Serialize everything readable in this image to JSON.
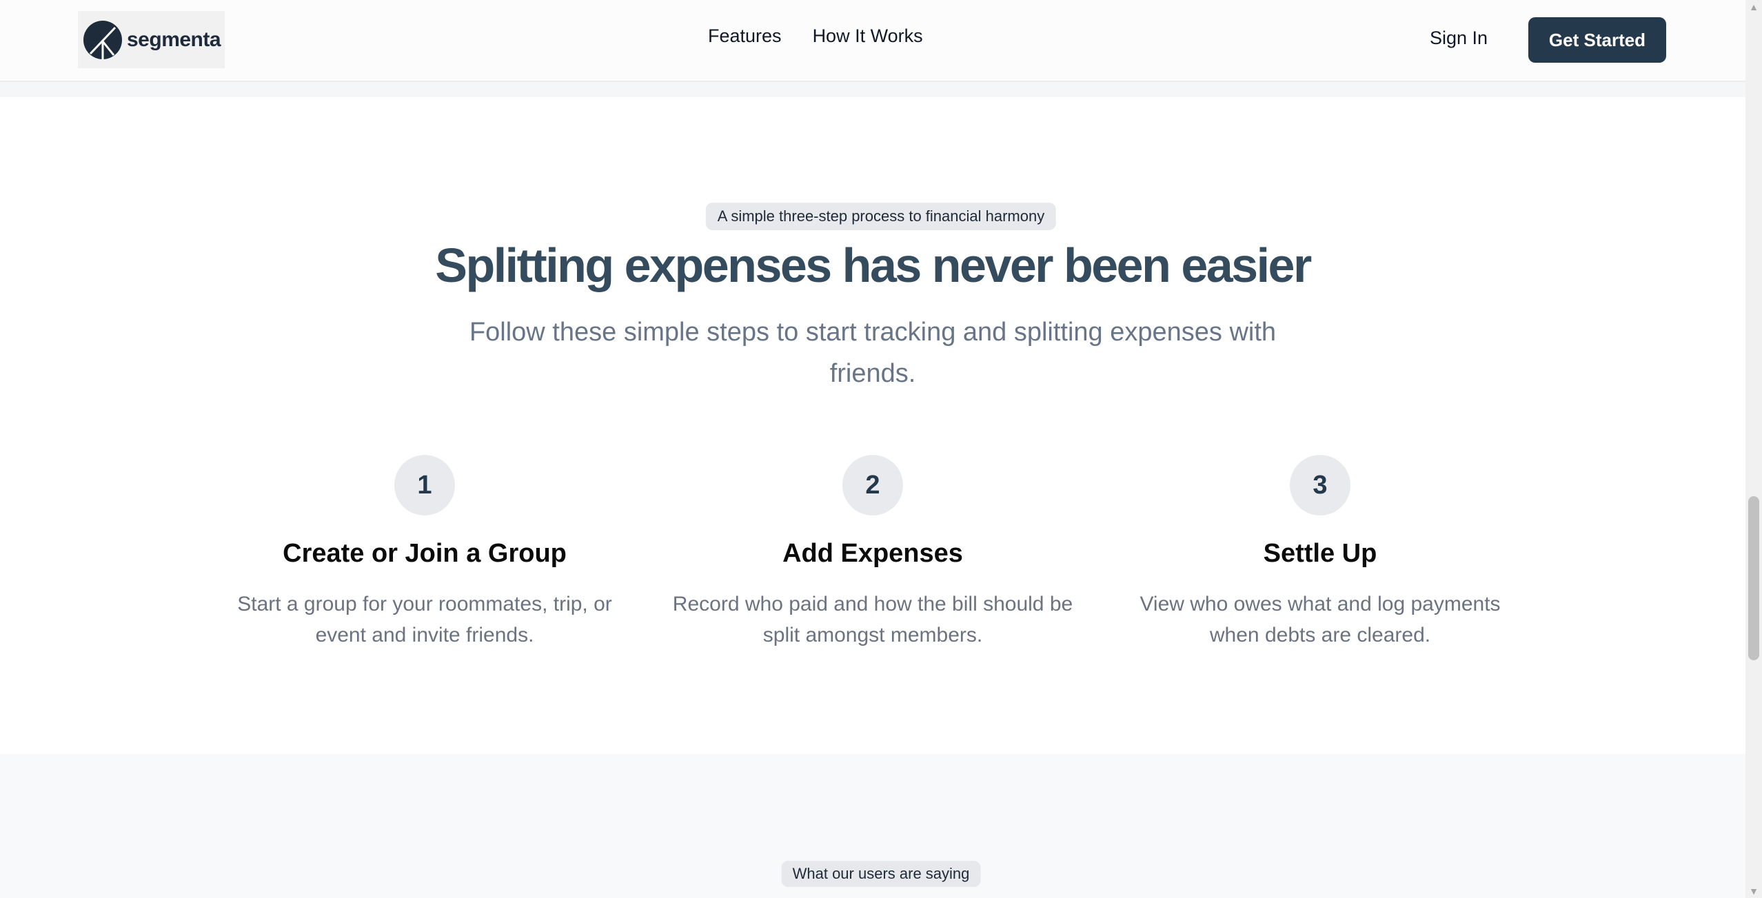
{
  "header": {
    "logo_text": "segmenta",
    "nav": [
      {
        "label": "Features"
      },
      {
        "label": "How It Works"
      }
    ],
    "sign_in": "Sign In",
    "get_started": "Get Started"
  },
  "how_it_works": {
    "eyebrow": "A simple three-step process to financial harmony",
    "title": "Splitting expenses has never been easier",
    "subtitle": "Follow these simple steps to start tracking and splitting expenses with friends.",
    "steps": [
      {
        "number": "1",
        "title": "Create or Join a Group",
        "description": "Start a group for your roommates, trip, or event and invite friends."
      },
      {
        "number": "2",
        "title": "Add Expenses",
        "description": "Record who paid and how the bill should be split amongst members."
      },
      {
        "number": "3",
        "title": "Settle Up",
        "description": "View who owes what and log payments when debts are cleared."
      }
    ]
  },
  "testimonials": {
    "eyebrow": "What our users are saying"
  },
  "colors": {
    "primary": "#25394d",
    "title": "#354b5e",
    "muted_text": "#687588"
  }
}
